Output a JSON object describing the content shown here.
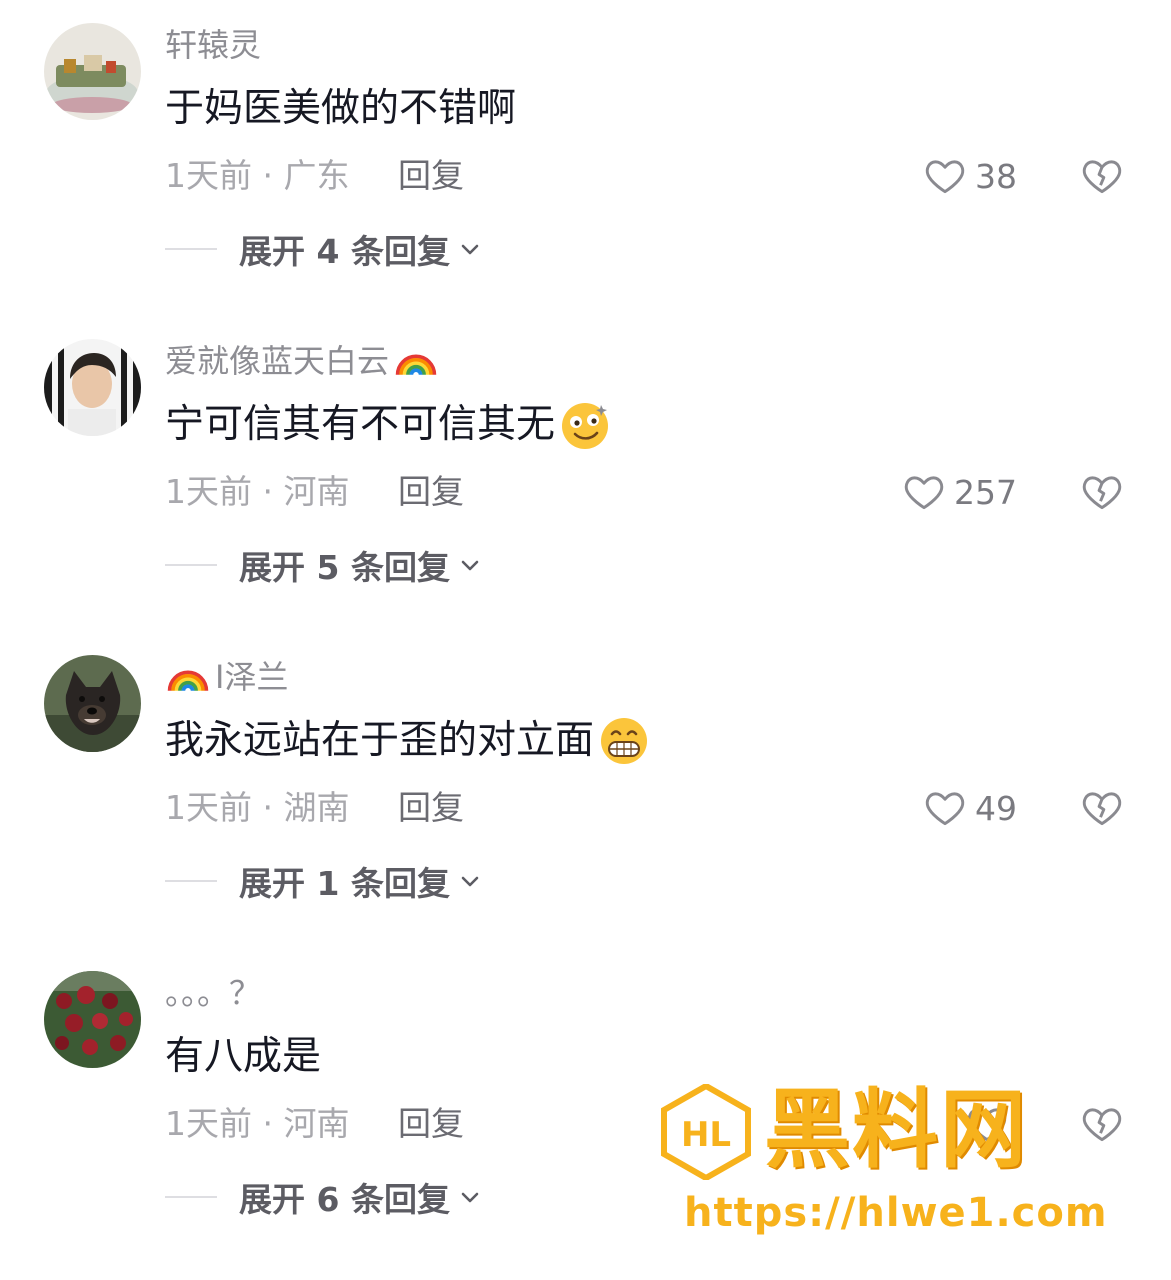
{
  "comments": [
    {
      "username": "轩辕灵",
      "text": "于妈医美做的不错啊",
      "time_location": "1天前 · 广东",
      "reply_label": "回复",
      "likes": "38",
      "expand_label": "展开 4 条回复",
      "avatar_icon": "landscape-painting-avatar"
    },
    {
      "username": "爱就像蓝天白云",
      "text": "宁可信其有不可信其无",
      "time_location": "1天前 · 河南",
      "reply_label": "回复",
      "likes": "257",
      "expand_label": "展开 5 条回复",
      "avatar_icon": "young-man-avatar",
      "username_emoji": "rainbow-emoji",
      "text_emoji": "dizzy-smile-emoji"
    },
    {
      "username": "I泽兰",
      "text": "我永远站在于歪的对立面",
      "time_location": "1天前 · 湖南",
      "reply_label": "回复",
      "likes": "49",
      "expand_label": "展开 1 条回复",
      "avatar_icon": "dog-avatar",
      "username_emoji": "rainbow-emoji",
      "text_emoji": "grin-emoji"
    },
    {
      "username": "。。。？",
      "text": "有八成是",
      "time_location": "1天前 · 河南",
      "reply_label": "回复",
      "likes": "",
      "expand_label": "展开 6 条回复",
      "avatar_icon": "roses-avatar"
    }
  ],
  "watermark": {
    "title": "黑料网",
    "url": "https://hlwe1.com",
    "logo_text": "HL"
  },
  "colors": {
    "username": "#8d8d93",
    "text": "#161823",
    "meta": "#a8a8ad",
    "watermark": "#f7b21c"
  }
}
